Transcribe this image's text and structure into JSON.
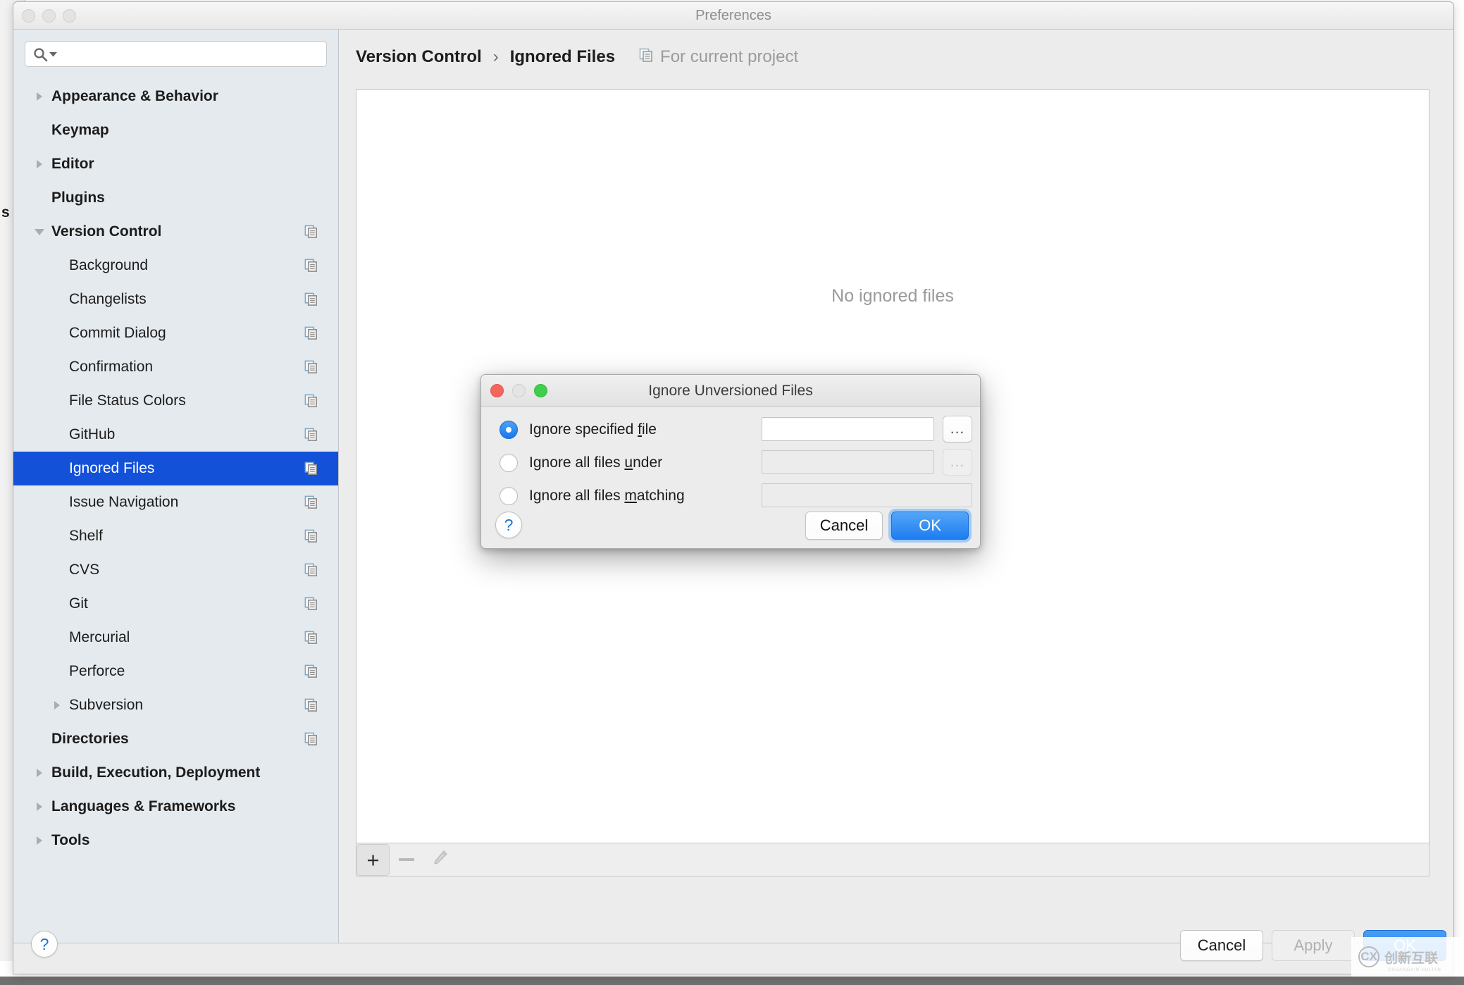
{
  "desktop": {
    "background_fragment_text": "s"
  },
  "window": {
    "title": "Preferences",
    "traffic_lights": [
      "close-button",
      "minimize-button",
      "zoom-button"
    ]
  },
  "sidebar": {
    "search": {
      "value": "",
      "placeholder": "",
      "icon": "search-icon",
      "dropdown_icon": "chevron-down-icon"
    },
    "items": [
      {
        "label": "Appearance & Behavior",
        "level": 0,
        "twisty": "collapsed",
        "copy_icon": false,
        "selected": false
      },
      {
        "label": "Keymap",
        "level": 0,
        "twisty": "none",
        "copy_icon": false,
        "selected": false
      },
      {
        "label": "Editor",
        "level": 0,
        "twisty": "collapsed",
        "copy_icon": false,
        "selected": false
      },
      {
        "label": "Plugins",
        "level": 0,
        "twisty": "none",
        "copy_icon": false,
        "selected": false
      },
      {
        "label": "Version Control",
        "level": 0,
        "twisty": "expanded",
        "copy_icon": true,
        "selected": false
      },
      {
        "label": "Background",
        "level": 1,
        "twisty": "none",
        "copy_icon": true,
        "selected": false
      },
      {
        "label": "Changelists",
        "level": 1,
        "twisty": "none",
        "copy_icon": true,
        "selected": false
      },
      {
        "label": "Commit Dialog",
        "level": 1,
        "twisty": "none",
        "copy_icon": true,
        "selected": false
      },
      {
        "label": "Confirmation",
        "level": 1,
        "twisty": "none",
        "copy_icon": true,
        "selected": false
      },
      {
        "label": "File Status Colors",
        "level": 1,
        "twisty": "none",
        "copy_icon": true,
        "selected": false
      },
      {
        "label": "GitHub",
        "level": 1,
        "twisty": "none",
        "copy_icon": true,
        "selected": false
      },
      {
        "label": "Ignored Files",
        "level": 1,
        "twisty": "none",
        "copy_icon": true,
        "selected": true
      },
      {
        "label": "Issue Navigation",
        "level": 1,
        "twisty": "none",
        "copy_icon": true,
        "selected": false
      },
      {
        "label": "Shelf",
        "level": 1,
        "twisty": "none",
        "copy_icon": true,
        "selected": false
      },
      {
        "label": "CVS",
        "level": 1,
        "twisty": "none",
        "copy_icon": true,
        "selected": false
      },
      {
        "label": "Git",
        "level": 1,
        "twisty": "none",
        "copy_icon": true,
        "selected": false
      },
      {
        "label": "Mercurial",
        "level": 1,
        "twisty": "none",
        "copy_icon": true,
        "selected": false
      },
      {
        "label": "Perforce",
        "level": 1,
        "twisty": "none",
        "copy_icon": true,
        "selected": false
      },
      {
        "label": "Subversion",
        "level": 1,
        "twisty": "collapsed",
        "copy_icon": true,
        "selected": false
      },
      {
        "label": "Directories",
        "level": 0,
        "twisty": "none",
        "copy_icon": true,
        "selected": false
      },
      {
        "label": "Build, Execution, Deployment",
        "level": 0,
        "twisty": "collapsed",
        "copy_icon": false,
        "selected": false
      },
      {
        "label": "Languages & Frameworks",
        "level": 0,
        "twisty": "collapsed",
        "copy_icon": false,
        "selected": false
      },
      {
        "label": "Tools",
        "level": 0,
        "twisty": "collapsed",
        "copy_icon": false,
        "selected": false
      }
    ]
  },
  "main": {
    "breadcrumb": {
      "parent": "Version Control",
      "separator": "›",
      "current": "Ignored Files"
    },
    "scope": {
      "icon": "copy-settings-icon",
      "label": "For current project"
    },
    "empty_state": "No ignored files",
    "toolbar": {
      "add_label": "+",
      "remove_label": "−",
      "edit_icon": "pencil-icon"
    }
  },
  "footer": {
    "help_label": "?",
    "cancel_label": "Cancel",
    "apply_label": "Apply",
    "ok_label": "OK"
  },
  "modal": {
    "title": "Ignore Unversioned Files",
    "traffic_lights": [
      "close-button",
      "minimize-button",
      "zoom-button"
    ],
    "options": [
      {
        "label_before": "Ignore specified ",
        "mnemonic": "f",
        "label_after": "ile",
        "selected": true,
        "value": "",
        "field_enabled": true,
        "browse_label": "...",
        "browse_enabled": true
      },
      {
        "label_before": "Ignore all files ",
        "mnemonic": "u",
        "label_after": "nder",
        "selected": false,
        "value": "",
        "field_enabled": false,
        "browse_label": "...",
        "browse_enabled": false
      },
      {
        "label_before": "Ignore all files ",
        "mnemonic": "m",
        "label_after": "atching",
        "selected": false,
        "value": "",
        "field_enabled": false,
        "browse_label": "",
        "browse_enabled": false
      }
    ],
    "help_label": "?",
    "cancel_label": "Cancel",
    "ok_label": "OK"
  },
  "watermark": {
    "logo": "cx-logo-icon",
    "text": "创新互联",
    "subtext": "CHUANGXIN HULIAN"
  },
  "colors": {
    "selection_blue": "#1351d8",
    "primary_blue": "#1d7df0",
    "sidebar_bg": "#e5eaee",
    "window_bg": "#ececec"
  }
}
